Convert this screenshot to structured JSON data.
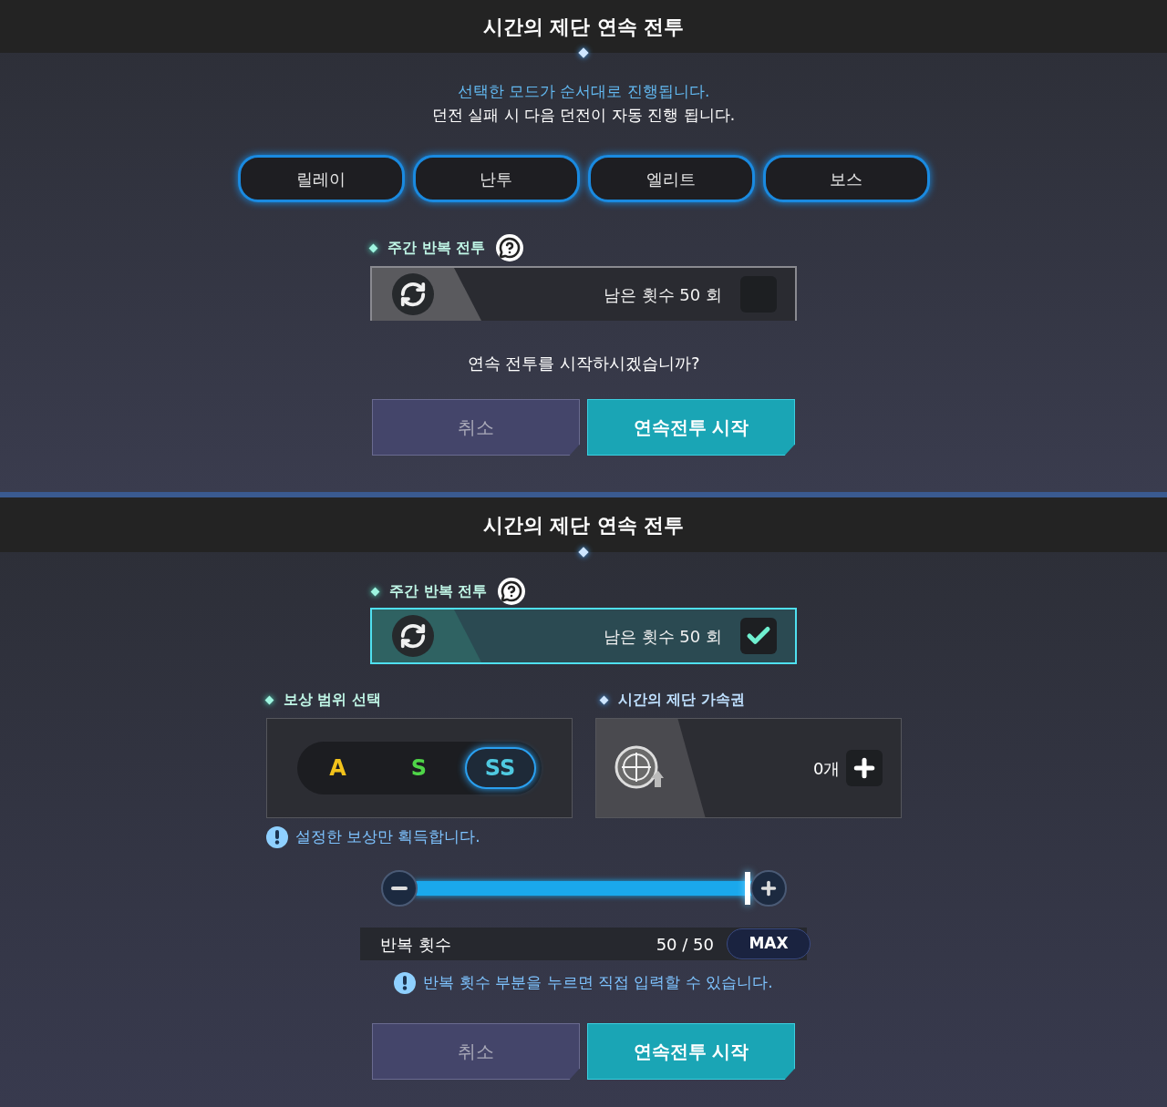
{
  "panels": [
    {
      "kind": "select",
      "title": "시간의 제단 연속 전투",
      "intro": [
        "선택한 모드가 순서대로 진행됩니다.",
        "던전 실패 시 다음 던전이 자동 진행 됩니다."
      ],
      "modes": [
        {
          "label": "릴레이"
        },
        {
          "label": "난투"
        },
        {
          "label": "엘리트"
        },
        {
          "label": "보스"
        }
      ],
      "weekly": {
        "label": "주간 반복 전투",
        "remaining": "남은 횟수 50 회",
        "checked": false
      },
      "question": "연속 전투를 시작하시겠습니까?",
      "buttons": [
        "취소",
        "연속전투 시작"
      ]
    },
    {
      "kind": "settings",
      "title": "시간의 제단 연속 전투",
      "weekly": {
        "label": "주간 반복 전투",
        "remaining": "남은 횟수 50 회",
        "checked": true
      },
      "reward": {
        "label": "보상 범위 선택",
        "grades": [
          {
            "label": "A",
            "color": "#f2c21b",
            "selected": false
          },
          {
            "label": "S",
            "color": "#4fd548",
            "selected": false
          },
          {
            "label": "SS",
            "color": "#4fc9e0",
            "selected": true
          }
        ],
        "note": "설정한 보상만 획득합니다."
      },
      "ticket": {
        "label": "시간의 제단 가속권",
        "count": "0개"
      },
      "slider": {
        "level": 1
      },
      "repeat": {
        "label": "반복 횟수",
        "value": "50 / 50",
        "max_button": "MAX"
      },
      "note": "반복 횟수 부분을 누르면 직접 입력할 수 있습니다.",
      "buttons": [
        "취소",
        "연속전투 시작"
      ]
    }
  ]
}
